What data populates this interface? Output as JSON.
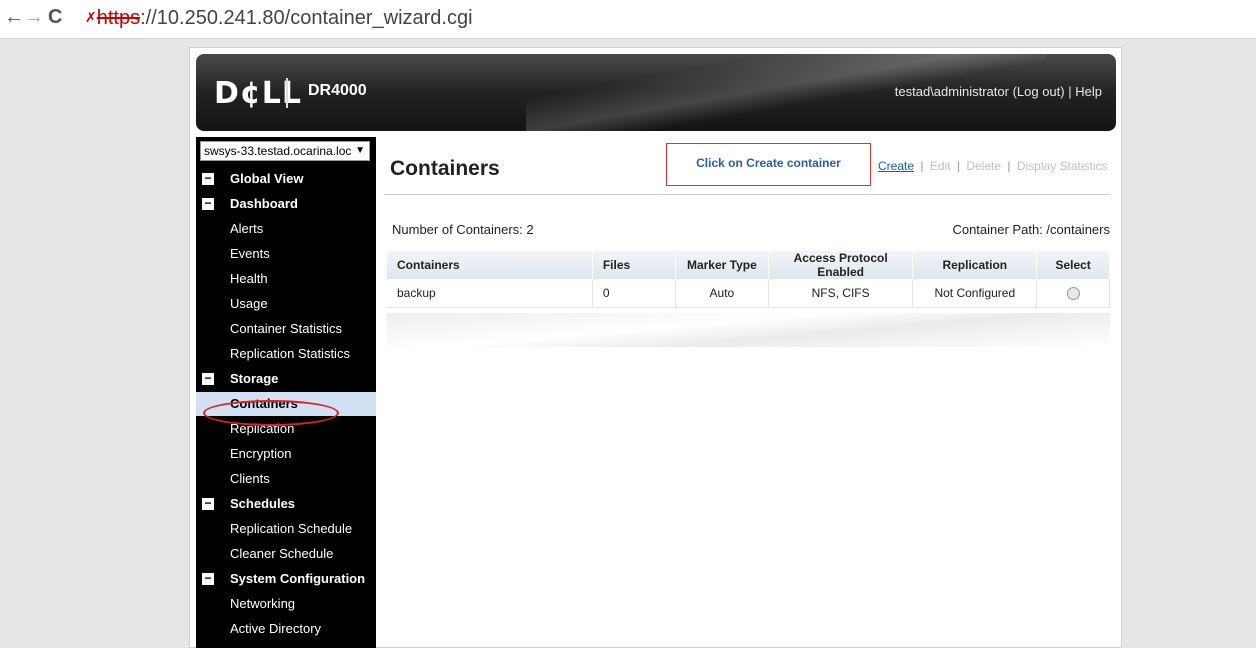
{
  "browser": {
    "url_scheme": "https",
    "url_rest": "://10.250.241.80/container_wizard.cgi",
    "back_icon": "←",
    "forward_icon": "→",
    "reload_icon": "C",
    "lock_icon": "✗"
  },
  "header": {
    "logo": "D¢LL",
    "product": "DR4000",
    "user": "testad\\administrator",
    "logout": "(Log out)",
    "separator": "|",
    "help": "Help"
  },
  "sidebar": {
    "system_selector": "swsys-33.testad.ocarina.loc",
    "items": [
      {
        "label": "Global View",
        "type": "section"
      },
      {
        "label": "Dashboard",
        "type": "section"
      },
      {
        "label": "Alerts",
        "type": "item"
      },
      {
        "label": "Events",
        "type": "item"
      },
      {
        "label": "Health",
        "type": "item"
      },
      {
        "label": "Usage",
        "type": "item"
      },
      {
        "label": "Container Statistics",
        "type": "item"
      },
      {
        "label": "Replication Statistics",
        "type": "item"
      },
      {
        "label": "Storage",
        "type": "section"
      },
      {
        "label": "Containers",
        "type": "item",
        "selected": true
      },
      {
        "label": "Replication",
        "type": "item"
      },
      {
        "label": "Encryption",
        "type": "item"
      },
      {
        "label": "Clients",
        "type": "item"
      },
      {
        "label": "Schedules",
        "type": "section"
      },
      {
        "label": "Replication Schedule",
        "type": "item"
      },
      {
        "label": "Cleaner Schedule",
        "type": "item"
      },
      {
        "label": "System Configuration",
        "type": "section"
      },
      {
        "label": "Networking",
        "type": "item"
      },
      {
        "label": "Active Directory",
        "type": "item"
      }
    ]
  },
  "main": {
    "title": "Containers",
    "annotation": "Click on Create container",
    "actions": {
      "create": "Create",
      "edit": "Edit",
      "delete": "Delete",
      "display_statistics": "Display Statistics",
      "separator": "|"
    },
    "count_label": "Number of Containers: 2",
    "path_label": "Container Path: /containers",
    "table": {
      "columns": [
        "Containers",
        "Files",
        "Marker Type",
        "Access Protocol Enabled",
        "Replication",
        "Select"
      ],
      "rows": [
        [
          "backup",
          "0",
          "Auto",
          "NFS, CIFS",
          "Not Configured",
          ""
        ]
      ]
    }
  },
  "colors": {
    "link": "#1a58c2",
    "annotation_red": "#e02020",
    "sidebar_bg": "#000000",
    "selected_bg": "#d2e0f3"
  }
}
